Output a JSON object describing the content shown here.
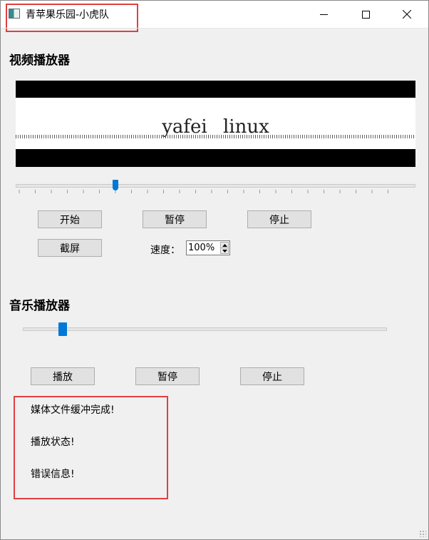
{
  "window": {
    "title": "青苹果乐园-小虎队",
    "controls": {
      "minimize_icon": "minimize-icon",
      "maximize_icon": "maximize-icon",
      "close_icon": "close-icon"
    }
  },
  "video_player": {
    "section_title": "视频播放器",
    "frame_text": "yafei linux",
    "progress": 0.25,
    "buttons": {
      "start": "开始",
      "pause": "暂停",
      "stop": "停止",
      "screenshot": "截屏"
    },
    "speed": {
      "label": "速度：",
      "value": "100%"
    }
  },
  "audio_player": {
    "section_title": "音乐播放器",
    "progress": 0.11,
    "buttons": {
      "play": "播放",
      "pause": "暂停",
      "stop": "停止"
    }
  },
  "status": {
    "lines": [
      "媒体文件缓冲完成!",
      "播放状态!",
      "错误信息!"
    ]
  },
  "colors": {
    "accent": "#0078d7",
    "highlight": "#e04040",
    "window_bg": "#f0f0f0"
  }
}
